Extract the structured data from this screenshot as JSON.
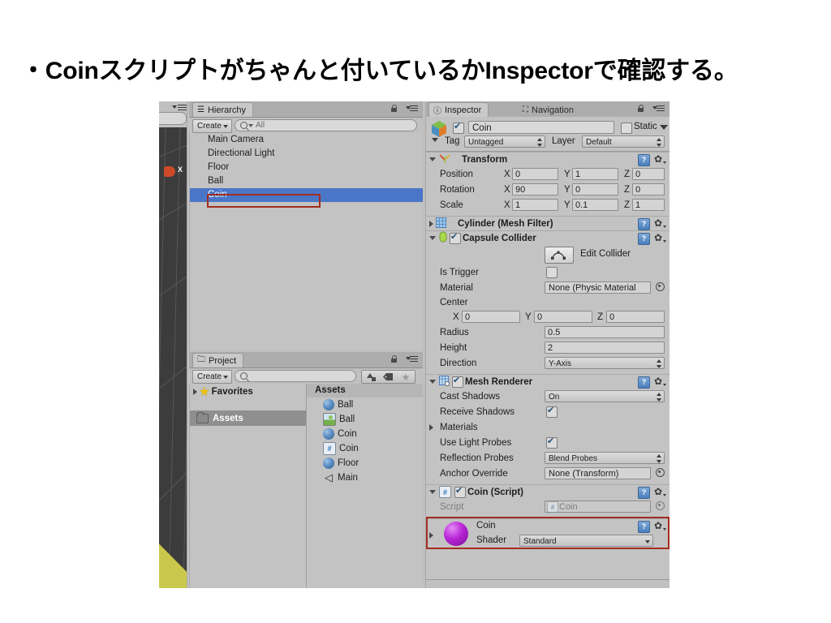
{
  "slide": {
    "title": "・Coinスクリプトがちゃんと付いているかInspectorで確認する。"
  },
  "hierarchy": {
    "tab_label": "Hierarchy",
    "create_label": "Create",
    "search_placeholder": "All",
    "items": [
      {
        "label": "Main Camera",
        "selected": false
      },
      {
        "label": "Directional Light",
        "selected": false
      },
      {
        "label": "Floor",
        "selected": false
      },
      {
        "label": "Ball",
        "selected": false
      },
      {
        "label": "Coin",
        "selected": true
      }
    ]
  },
  "project": {
    "tab_label": "Project",
    "create_label": "Create",
    "search_placeholder": "",
    "favorites_label": "Favorites",
    "assets_folder_label": "Assets",
    "assets_column_header": "Assets",
    "assets": [
      {
        "label": "Ball",
        "icon": "sphere-mesh-icon"
      },
      {
        "label": "Ball",
        "icon": "material-icon"
      },
      {
        "label": "Coin",
        "icon": "sphere-mesh-icon"
      },
      {
        "label": "Coin",
        "icon": "csharp-script-icon"
      },
      {
        "label": "Floor",
        "icon": "sphere-mesh-icon"
      },
      {
        "label": "Main",
        "icon": "unity-scene-icon"
      }
    ]
  },
  "inspector": {
    "tab_label": "Inspector",
    "nav_tab_label": "Navigation",
    "gameobject": {
      "name": "Coin",
      "enabled": true,
      "static_label": "Static",
      "tag_label": "Tag",
      "tag_value": "Untagged",
      "layer_label": "Layer",
      "layer_value": "Default"
    },
    "transform": {
      "title": "Transform",
      "rows": [
        {
          "label": "Position",
          "x": "0",
          "y": "1",
          "z": "0"
        },
        {
          "label": "Rotation",
          "x": "90",
          "y": "0",
          "z": "0"
        },
        {
          "label": "Scale",
          "x": "1",
          "y": "0.1",
          "z": "1"
        }
      ],
      "axis_x": "X",
      "axis_y": "Y",
      "axis_z": "Z"
    },
    "mesh_filter": {
      "title": "Cylinder (Mesh Filter)"
    },
    "capsule_collider": {
      "title": "Capsule Collider",
      "enabled": true,
      "edit_collider_label": "Edit Collider",
      "is_trigger_label": "Is Trigger",
      "is_trigger_value": false,
      "material_label": "Material",
      "material_value": "None (Physic Material",
      "center_label": "Center",
      "center_x": "0",
      "center_y": "0",
      "center_z": "0",
      "axis_x": "X",
      "axis_y": "Y",
      "axis_z": "Z",
      "radius_label": "Radius",
      "radius_value": "0.5",
      "height_label": "Height",
      "height_value": "2",
      "direction_label": "Direction",
      "direction_value": "Y-Axis"
    },
    "mesh_renderer": {
      "title": "Mesh Renderer",
      "enabled": true,
      "cast_shadows_label": "Cast Shadows",
      "cast_shadows_value": "On",
      "receive_shadows_label": "Receive Shadows",
      "receive_shadows_value": true,
      "materials_label": "Materials",
      "use_light_probes_label": "Use Light Probes",
      "use_light_probes_value": true,
      "reflection_probes_label": "Reflection Probes",
      "reflection_probes_value": "Blend Probes",
      "anchor_override_label": "Anchor Override",
      "anchor_override_value": "None (Transform)"
    },
    "coin_script": {
      "title": "Coin (Script)",
      "enabled": true,
      "script_label": "Script",
      "script_value": "Coin"
    },
    "material_preview": {
      "name": "Coin",
      "shader_label": "Shader",
      "shader_value": "Standard"
    }
  },
  "colors": {
    "selection_blue": "#4a76c8",
    "highlight_red": "#a32d20",
    "panel_grey": "#c3c3c3",
    "scene_dark": "#3c3c3c",
    "scene_yellow": "#c9c84c",
    "material_purple": "#b825d6"
  }
}
